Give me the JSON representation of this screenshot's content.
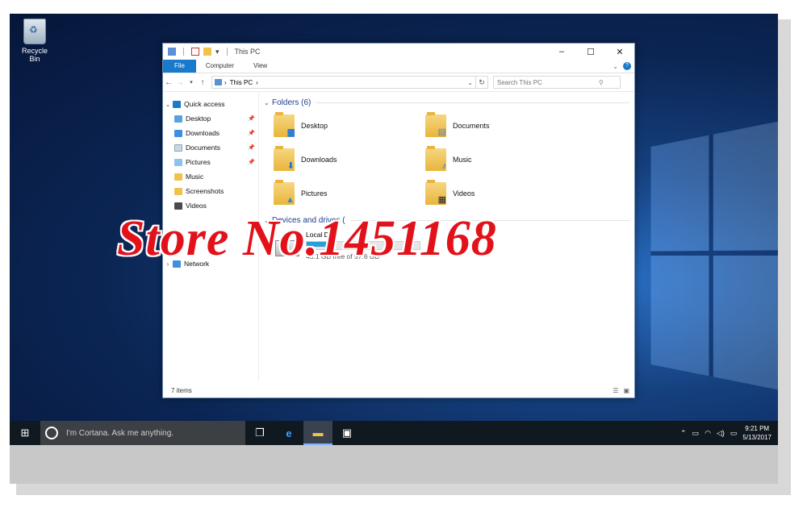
{
  "desktop": {
    "recycle_bin_label": "Recycle Bin"
  },
  "watermark": "Store No.1451168",
  "explorer": {
    "title": "This PC",
    "ribbon_tabs": [
      "File",
      "Computer",
      "View"
    ],
    "address": "This PC",
    "search_placeholder": "Search This PC",
    "nav": {
      "quick_access": "Quick access",
      "items": [
        {
          "label": "Desktop",
          "pinned": true
        },
        {
          "label": "Downloads",
          "pinned": true
        },
        {
          "label": "Documents",
          "pinned": true
        },
        {
          "label": "Pictures",
          "pinned": true
        },
        {
          "label": "Music",
          "pinned": false
        },
        {
          "label": "Screenshots",
          "pinned": false
        },
        {
          "label": "Videos",
          "pinned": false
        }
      ],
      "network": "Network"
    },
    "folders_header": "Folders (6)",
    "folders": [
      {
        "label": "Desktop",
        "icon": "desktop-folder"
      },
      {
        "label": "Documents",
        "icon": "documents-folder"
      },
      {
        "label": "Downloads",
        "icon": "downloads-folder"
      },
      {
        "label": "Music",
        "icon": "music-folder"
      },
      {
        "label": "Pictures",
        "icon": "pictures-folder"
      },
      {
        "label": "Videos",
        "icon": "videos-folder"
      }
    ],
    "devices_header": "Devices and drives (",
    "drive": {
      "name": "Local Disk",
      "free_text": "45.1 GB free of 57.6 GB",
      "used_fraction": 0.22
    },
    "status": "7 items"
  },
  "taskbar": {
    "cortana_placeholder": "I'm Cortana. Ask me anything.",
    "time": "9:21 PM",
    "date": "5/13/2017"
  },
  "colors": {
    "accent": "#1979ca",
    "watermark": "#e2121b",
    "taskbar": "#101820"
  }
}
